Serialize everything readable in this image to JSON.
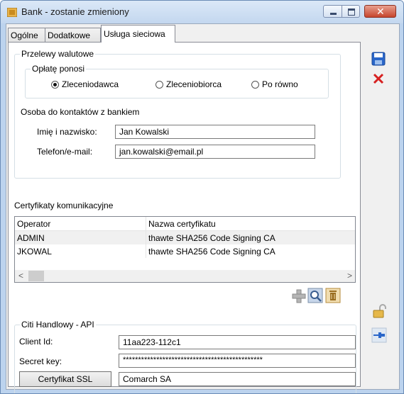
{
  "window": {
    "title": "Bank - zostanie zmieniony"
  },
  "tabs": [
    {
      "label": "Ogólne"
    },
    {
      "label": "Dodatkowe"
    },
    {
      "label": "Usługa sieciowa"
    }
  ],
  "foreign_transfers": {
    "group_label": "Przelewy walutowe",
    "fee_payer": {
      "group_label": "Opłatę ponosi",
      "options": [
        {
          "label": "Zleceniodawca",
          "selected": true
        },
        {
          "label": "Zleceniobiorca",
          "selected": false
        },
        {
          "label": "Po równo",
          "selected": false
        }
      ]
    },
    "contact": {
      "heading": "Osoba do kontaktów z bankiem",
      "name_label": "Imię i nazwisko:",
      "name_value": "Jan Kowalski",
      "phone_label": "Telefon/e-mail:",
      "phone_value": "jan.kowalski@email.pl"
    }
  },
  "certificates": {
    "heading": "Certyfikaty komunikacyjne",
    "columns": [
      "Operator",
      "Nazwa certyfikatu"
    ],
    "rows": [
      {
        "operator": "ADMIN",
        "certificate": "thawte SHA256 Code Signing CA"
      },
      {
        "operator": "JKOWAL",
        "certificate": "thawte SHA256 Code Signing CA"
      }
    ],
    "scroll_left": "<",
    "scroll_right": ">"
  },
  "citi": {
    "group_label": "Citi Handlowy - API",
    "client_id_label": "Client Id:",
    "client_id_value": "11aa223-112c1",
    "secret_label": "Secret key:",
    "secret_value": "**********************************************",
    "ssl_button": "Certyfikat SSL",
    "ssl_value": "Comarch SA"
  },
  "colors": {
    "save": "#2a66c9",
    "delete": "#d62020"
  }
}
